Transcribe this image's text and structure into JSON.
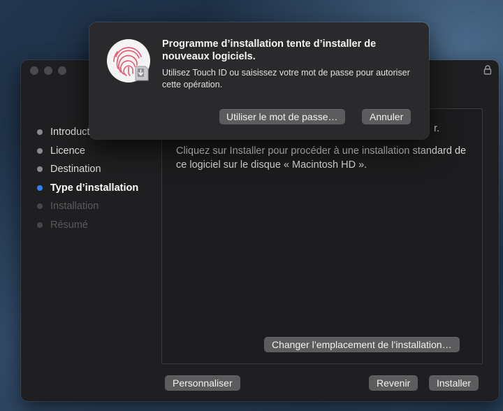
{
  "window": {
    "steps": [
      {
        "label": "Introduction",
        "state": "done"
      },
      {
        "label": "Licence",
        "state": "done"
      },
      {
        "label": "Destination",
        "state": "done"
      },
      {
        "label": "Type d’installation",
        "state": "active"
      },
      {
        "label": "Installation",
        "state": "disabled"
      },
      {
        "label": "Résumé",
        "state": "disabled"
      }
    ],
    "content": {
      "partial_text": "r.",
      "body_text": "Cliquez sur Installer pour procéder à une installation standard de ce logiciel sur le disque « Macintosh HD »."
    },
    "buttons": {
      "change_location": "Changer l’emplacement de l’installation…",
      "customize": "Personnaliser",
      "back": "Revenir",
      "install": "Installer"
    }
  },
  "dialog": {
    "title": "Programme d’installation tente d’installer de nouveaux logiciels.",
    "message": "Utilisez Touch ID ou saisissez votre mot de passe pour autoriser cette opération.",
    "use_password_button": "Utiliser le mot de passe…",
    "cancel_button": "Annuler"
  },
  "icons": {
    "lock": "lock-icon",
    "touchid": "touch-id-fingerprint-icon"
  },
  "colors": {
    "active_step": "#2f7ff5",
    "fingerprint": "#e8576f"
  }
}
